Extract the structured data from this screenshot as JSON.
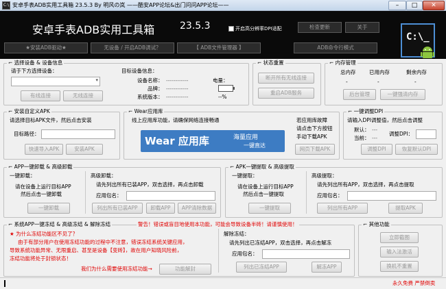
{
  "window": {
    "title": "安卓手表ADB实用工具箱   23.5.3   By 明风の岚       ——酷安APP论坛&出门问问APP论坛——",
    "app_icon": "C:\\",
    "minimize": "–",
    "maximize": "□",
    "close": "✕"
  },
  "header": {
    "title": "安卓手表ADB实用工具箱",
    "version": "23.5.3",
    "hd_checkbox_label": "开启高分辨率DPI适配",
    "check_update": "检查更新",
    "about": "关于",
    "install_driver": "★安装ADB驱动★",
    "no_device_help": "无设备 / 开启ADB调试？",
    "file_manager": "【 ADB文件管理器 】",
    "cmd_mode": "ADB命令行模式",
    "logo_text": "C:\\_",
    "logo_icon": "android-icon"
  },
  "device": {
    "group": "选择设备 & 设备信息",
    "prompt": "请于下方选择设备：",
    "btn_wired": "有线连接",
    "btn_wireless": "无线连接",
    "target_info": "目标设备信息：",
    "model_label": "设备名称：",
    "model_value": "------------",
    "brand_label": "品牌：",
    "brand_value": "------------",
    "sys_label": "系统版本：",
    "sys_value": "------------",
    "battery_label": "电量：",
    "battery_value": "--%"
  },
  "status_reset": {
    "group": "状态重置",
    "btn_disconnect": "断开所有无线连接",
    "btn_restart": "重启ADB服务"
  },
  "memory": {
    "group": "内存管理",
    "total": "总内存",
    "used": "已用内存",
    "free": "剩余内存",
    "total_value": "-",
    "used_value": "-",
    "free_value": "-",
    "btn_bg": "后台管理",
    "btn_clean": "一键强清内存"
  },
  "apk_install": {
    "group": "安装自定义APK",
    "hint": "请选择目标APK文件，然后点击安装",
    "path_label": "目标路径：",
    "btn_import": "快速导入APK",
    "btn_install": "安装APK"
  },
  "wear": {
    "group": "Wear应用库",
    "hint": "线上应用库功能，请确保网络连接畅通",
    "banner": "Wear 应用库",
    "slogan1": "海量应用",
    "slogan2": "一键直达",
    "fail_hint1": "若应用库故障",
    "fail_hint2": "请点击下方按钮",
    "fail_hint3": "手动下载APK",
    "btn_download": "网页下载APK"
  },
  "dpi": {
    "group": "一键调整DPI",
    "hint": "请输入DPI调整值，然后点击调整",
    "default_label": "默认：",
    "default_value": "---",
    "current_label": "当前：",
    "current_value": "---",
    "adjust_label": "调整DPI：",
    "btn_adjust": "调整DPI",
    "btn_restore": "恢复默认DPI"
  },
  "uninstall": {
    "group": "APP一键卸载 & 高级卸载",
    "simple_title": "一键卸载：",
    "simple_hint1": "请在设备上运行目标APP",
    "simple_hint2": "然后点击一键卸载",
    "btn_simple": "一键卸载",
    "adv_title": "高级卸载：",
    "adv_hint": "请先列出所有已装APP，双击选择，再点击卸载",
    "pkg_label": "应用包名：",
    "btn_list": "列出所有已装APP",
    "btn_uninstall": "卸载APP",
    "btn_clear": "APP清除数据"
  },
  "extract": {
    "group": "APK一键提取 & 高级提取",
    "simple_title": "一键提取：",
    "simple_hint1": "请在设备上运行目标APP",
    "simple_hint2": "然后点击一键提取",
    "btn_simple": "一键提取",
    "adv_title": "高级提取：",
    "adv_hint": "请先列出所有APP，双击选择，再点击提取",
    "pkg_label": "应用包名：",
    "btn_list": "列出所有APP",
    "btn_extract": "提取APK"
  },
  "freeze": {
    "group": "系统APP一键冻结 & 高级冻结 & 解除冻结",
    "warning": "警告！错误或盲目地使用本功能，可能会导致设备半砖！请谨慎使用！",
    "q1": "★ 为什么冻结功能区不见了？",
    "p1": "由于有部分用户在使用冻结功能的过程中不注意，错误冻结系统关键应用，",
    "p2": "导致系统功能异常、无限重启、甚至是设备【变砖】，故在用户知晓风险前，",
    "p3": "冻结功能将处于封锁状态！",
    "why": "我们为什么需要使用冻结功能→",
    "btn_unlock": "功能解封",
    "unfreeze_title": "解除冻结：",
    "unfreeze_hint": "请先列出已冻结APP，双击选择，再点击解冻",
    "pkg_label": "应用包名：",
    "btn_list": "列出已冻结APP",
    "btn_unfreeze": "解冻APP"
  },
  "other": {
    "group": "其他功能",
    "btn_screenshot": "立即截图",
    "btn_input": "输入法激活",
    "btn_wallpaper": "换机不重置"
  },
  "footer": {
    "free_note": "永久免费 严禁倒卖"
  }
}
